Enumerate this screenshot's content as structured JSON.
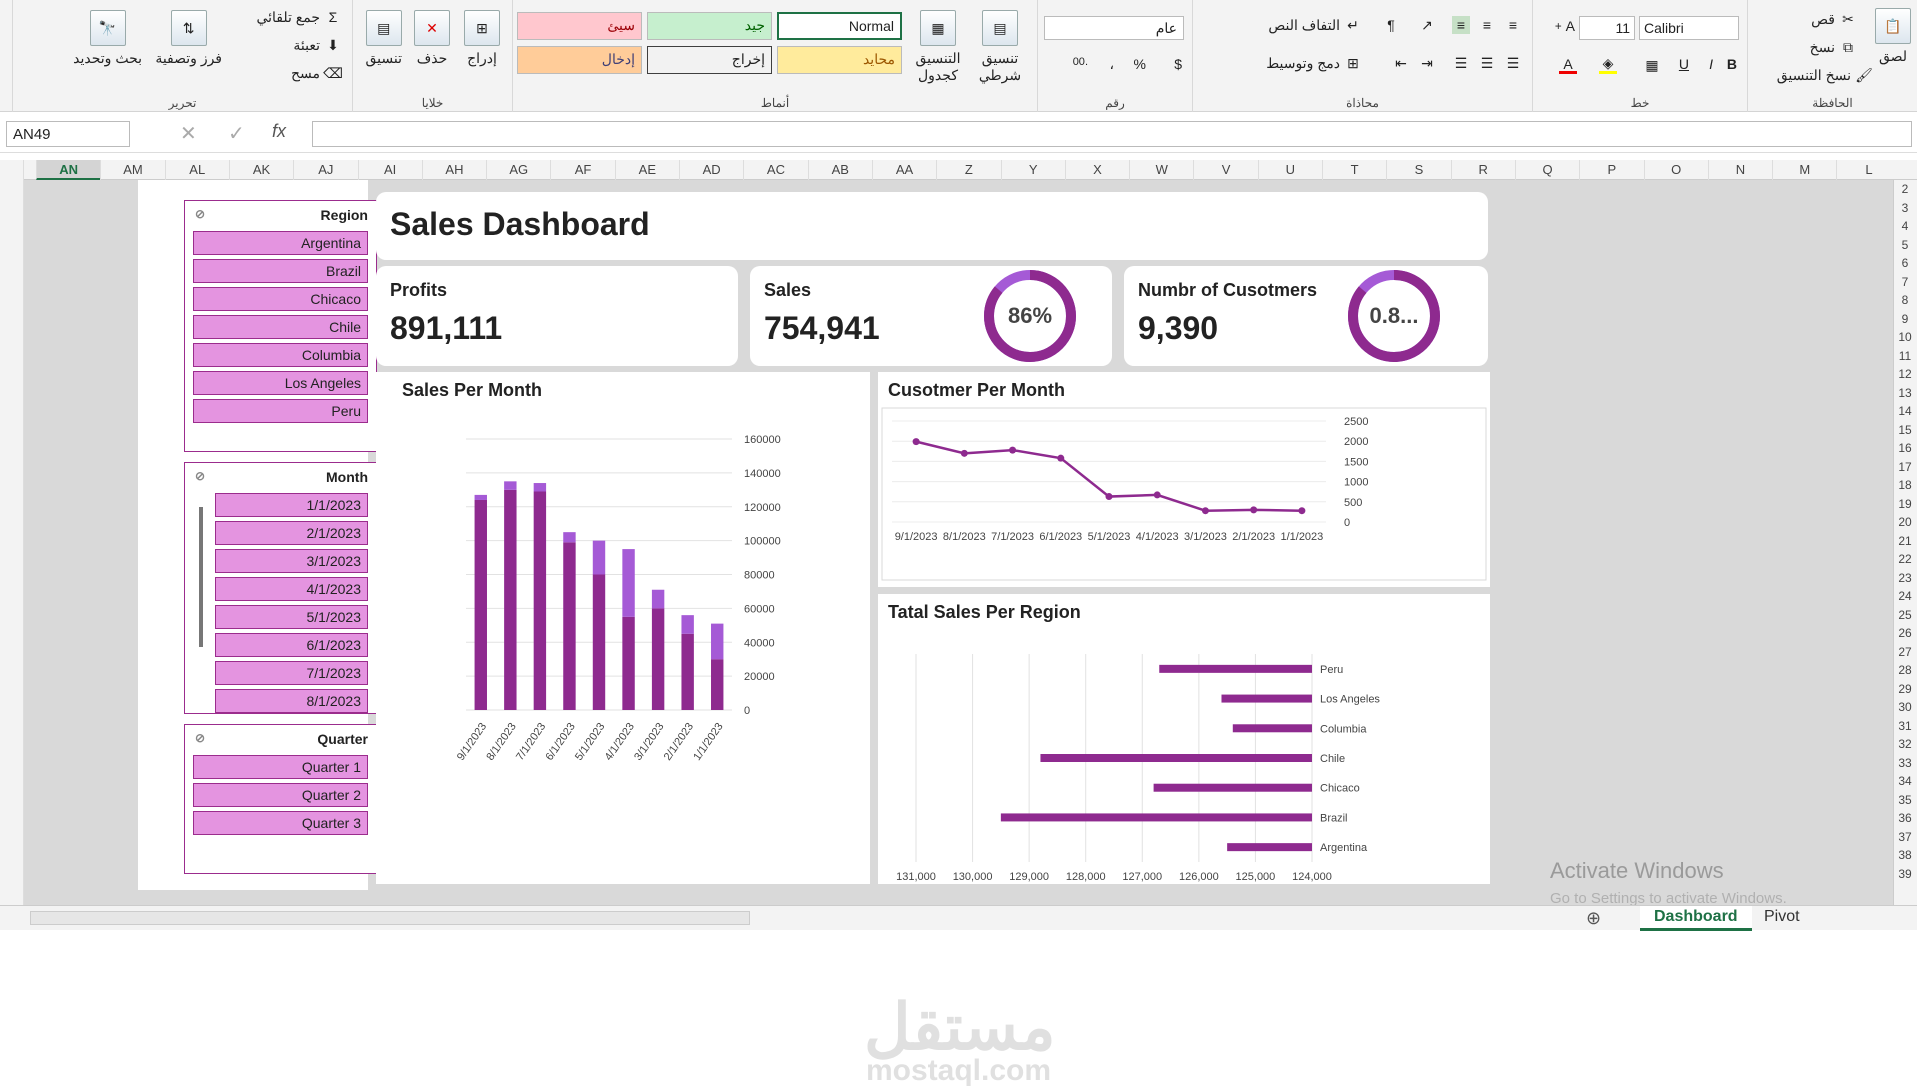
{
  "ribbon": {
    "clipboard": {
      "label": "الحافظة",
      "paste": "لصق",
      "cut": "قص",
      "copy": "نسخ",
      "format_painter": "نسخ التنسيق"
    },
    "font": {
      "label": "خط",
      "name": "Calibri",
      "size": "11",
      "bold": "B",
      "italic": "I",
      "underline": "U"
    },
    "alignment": {
      "label": "محاذاة",
      "wrap": "التفاف النص",
      "merge": "دمج وتوسيط"
    },
    "number": {
      "label": "رقم",
      "format": "عام",
      "currency": "$",
      "percent": "%",
      "comma": "،"
    },
    "styles": {
      "label": "أنماط",
      "conditional": "تنسيق شرطي",
      "as_table": "التنسيق كجدول",
      "bad": "سيئ",
      "good": "جيد",
      "normal": "Normal",
      "input": "إدخال",
      "output": "إخراج",
      "neutral": "محايد"
    },
    "cells": {
      "label": "خلايا",
      "insert": "إدراج",
      "delete": "حذف",
      "format": "تنسيق"
    },
    "editing": {
      "label": "تحرير",
      "autosum": "جمع تلقائي",
      "fill": "تعبئة",
      "clear": "مسح",
      "sort": "فرز وتصفية",
      "find": "بحث وتحديد"
    }
  },
  "formula_bar": {
    "name_box": "AN49",
    "fx": "fx"
  },
  "columns": [
    "AN",
    "AM",
    "AL",
    "AK",
    "AJ",
    "AI",
    "AH",
    "AG",
    "AF",
    "AE",
    "AD",
    "AC",
    "AB",
    "AA",
    "Z",
    "Y",
    "X",
    "W",
    "V",
    "U",
    "T",
    "S",
    "R",
    "Q",
    "P",
    "O",
    "N",
    "M",
    "L"
  ],
  "rows": [
    "2",
    "3",
    "4",
    "5",
    "6",
    "7",
    "8",
    "9",
    "10",
    "11",
    "12",
    "13",
    "14",
    "15",
    "16",
    "17",
    "18",
    "19",
    "20",
    "21",
    "22",
    "23",
    "24",
    "25",
    "26",
    "27",
    "28",
    "29",
    "30",
    "31",
    "32",
    "33",
    "34",
    "35",
    "36",
    "37",
    "38",
    "39"
  ],
  "slicers": {
    "region": {
      "title": "Region",
      "items": [
        "Argentina",
        "Brazil",
        "Chicaco",
        "Chile",
        "Columbia",
        "Los Angeles",
        "Peru"
      ]
    },
    "month": {
      "title": "Month",
      "items": [
        "1/1/2023",
        "2/1/2023",
        "3/1/2023",
        "4/1/2023",
        "5/1/2023",
        "6/1/2023",
        "7/1/2023",
        "8/1/2023"
      ]
    },
    "quarter": {
      "title": "Quarter",
      "items": [
        "Quarter 1",
        "Quarter 2",
        "Quarter 3"
      ]
    }
  },
  "dashboard": {
    "title": "Sales Dashboard"
  },
  "kpis": {
    "profits": {
      "label": "Profits",
      "value": "891,111"
    },
    "sales": {
      "label": "Sales",
      "value": "754,941",
      "ring_label": "86%",
      "ring_fraction": 0.86
    },
    "customers": {
      "label": "Numbr of Cusotmers",
      "value": "9,390",
      "ring_label": "0.8...",
      "ring_fraction": 0.86
    }
  },
  "colors": {
    "purple_dark": "#8e2a8f",
    "purple_light": "#a55ad6",
    "slicer_item": "#e494e0",
    "accent_green": "#1e7145"
  },
  "charts": {
    "sales_month": {
      "title": "Sales Per Month"
    },
    "customer_month": {
      "title": "Cusotmer Per Month"
    },
    "region_sales": {
      "title": "Tatal Sales Per Region"
    }
  },
  "chart_data": [
    {
      "type": "bar",
      "id": "sales_month",
      "title": "Sales Per Month",
      "categories": [
        "9/1/2023",
        "8/1/2023",
        "7/1/2023",
        "6/1/2023",
        "5/1/2023",
        "4/1/2023",
        "3/1/2023",
        "2/1/2023",
        "1/1/2023"
      ],
      "series": [
        {
          "values": [
            124000,
            130000,
            129000,
            99000,
            80000,
            55000,
            60000,
            45000,
            30000
          ]
        },
        {
          "values": [
            3000,
            5000,
            5000,
            6000,
            20000,
            40000,
            11000,
            11000,
            21000
          ]
        }
      ],
      "ylim": [
        0,
        160000
      ],
      "yticks": [
        "0",
        "20000",
        "40000",
        "60000",
        "80000",
        "100000",
        "120000",
        "140000",
        "160000"
      ],
      "grid": true
    },
    {
      "type": "line",
      "id": "customer_month",
      "title": "Cusotmer Per Month",
      "categories": [
        "9/1/2023",
        "8/1/2023",
        "7/1/2023",
        "6/1/2023",
        "5/1/2023",
        "4/1/2023",
        "3/1/2023",
        "2/1/2023",
        "1/1/2023"
      ],
      "series": [
        {
          "values": [
            1990,
            1700,
            1780,
            1580,
            630,
            670,
            280,
            300,
            280
          ]
        }
      ],
      "ylim": [
        0,
        2500
      ],
      "yticks": [
        "0",
        "500",
        "1000",
        "1500",
        "2000",
        "2500"
      ],
      "grid": true
    },
    {
      "type": "bar",
      "id": "region_sales",
      "title": "Tatal Sales Per Region",
      "categories": [
        "Peru",
        "Los Angeles",
        "Columbia",
        "Chile",
        "Chicaco",
        "Brazil",
        "Argentina"
      ],
      "series": [
        {
          "values": [
            126700,
            125600,
            125400,
            128800,
            126800,
            129500,
            125500
          ]
        }
      ],
      "xlim": [
        124000,
        131000
      ],
      "xticks": [
        "131,000",
        "130,000",
        "129,000",
        "128,000",
        "127,000",
        "126,000",
        "125,000",
        "124,000"
      ],
      "grid": true
    }
  ],
  "sheet_tabs": [
    "Dashboard",
    "Pivot"
  ],
  "windows_notice": {
    "title": "Activate Windows",
    "sub": "Go to Settings to activate Windows."
  },
  "watermark": {
    "logo": "مستقل",
    "site": "mostaql.com"
  }
}
